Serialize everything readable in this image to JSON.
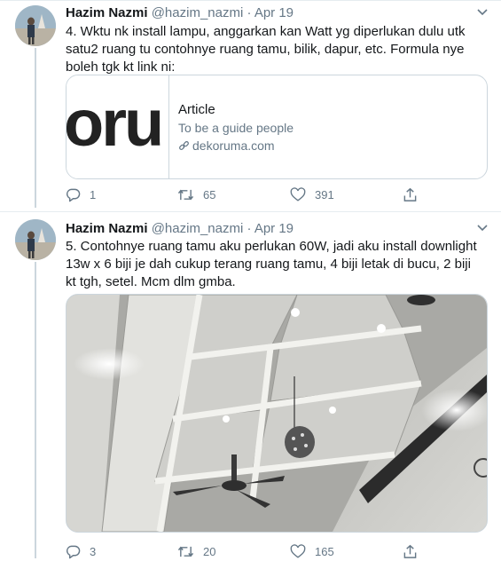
{
  "tweets": [
    {
      "author_name": "Hazim Nazmi",
      "handle": "@hazim_nazmi",
      "separator": "·",
      "date": "Apr 19",
      "text": "4. Wktu nk install lampu, anggarkan kan Watt yg diperlukan dulu utk satu2 ruang tu contohnye ruang tamu, bilik, dapur, etc. Formula nye boleh tgk kt link ni:",
      "card": {
        "logo_text": "oru",
        "kind": "Article",
        "description": "To be a guide people",
        "domain": "dekoruma.com"
      },
      "replies": "1",
      "retweets": "65",
      "likes": "391"
    },
    {
      "author_name": "Hazim Nazmi",
      "handle": "@hazim_nazmi",
      "separator": "·",
      "date": "Apr 19",
      "text": "5. Contohnye ruang tamu aku perlukan 60W, jadi aku install downlight 13w x 6 biji je dah cukup terang ruang tamu, 4 biji letak di bucu, 2 biji kt tgh, setel. Mcm dlm gmba.",
      "replies": "3",
      "retweets": "20",
      "likes": "165"
    }
  ],
  "colors": {
    "text": "#14171a",
    "secondary": "#657786",
    "border": "#ccd6dd"
  },
  "icons": [
    "reply-icon",
    "retweet-icon",
    "like-icon",
    "share-icon",
    "chevron-down-icon",
    "link-icon"
  ]
}
